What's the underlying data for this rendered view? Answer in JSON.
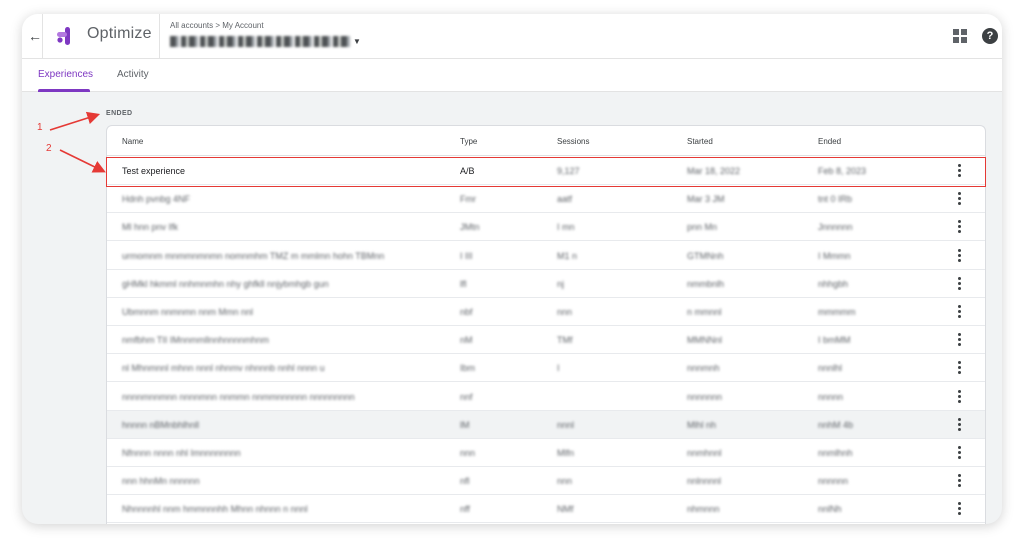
{
  "header": {
    "logo_text": "Optimize",
    "breadcrumb": "All accounts > My Account",
    "account_name": "Ent. Hered. Ptdd.Pty"
  },
  "tabs": [
    {
      "label": "Experiences",
      "active": true
    },
    {
      "label": "Activity",
      "active": false
    }
  ],
  "section": {
    "label": "ENDED"
  },
  "table": {
    "columns": [
      "Name",
      "Type",
      "Sessions",
      "Started",
      "Ended"
    ],
    "rows": [
      {
        "name": "Test experience",
        "type": "A/B",
        "sessions": "9,127",
        "started": "Mar 18, 2022",
        "ended": "Feb 8, 2023"
      },
      {
        "name": "Hdnh pvnbg 4NF",
        "type": "Fmr",
        "sessions": "aatf",
        "started": "Mar 3 JM",
        "ended": "tnt 0 IRb"
      },
      {
        "name": "Ml hnn pnv Ifk",
        "type": "JMtn",
        "sessions": "I mn",
        "started": "pnn Mn",
        "ended": "Jnnnnnn"
      },
      {
        "name": "urmomnm mnmmnmnmn nomnmhm TMZ m mmlmn hohn TBMnn",
        "type": "I III",
        "sessions": "M1 n",
        "started": "GTMNnh",
        "ended": "I Mmmn"
      },
      {
        "name": "gHMkl hkmml nnhmnmhn nhy ghfkll nnjybmhgb gun",
        "type": "lfl",
        "sessions": "nj",
        "started": "nmmbnlh",
        "ended": "nhhgbh"
      },
      {
        "name": "Ubmnnm nnmnmn nnm Mmn nnl",
        "type": "nbf",
        "sessions": "nnn",
        "started": "n mmnnl",
        "ended": "mmmmm"
      },
      {
        "name": "nmfbhm TII IMnnmmllnnhnnnnmhnm",
        "type": "nM",
        "sessions": "TMf",
        "started": "MMNNnl",
        "ended": "I bmMM"
      },
      {
        "name": "nl Mhnmnnl mhnn nnnl nhnmv nhnnnb nnhl nnnn u",
        "type": "Ibm",
        "sessions": "I",
        "started": "nnnmnh",
        "ended": "nnnlhl"
      },
      {
        "name": "nnnnmnnmnn nnnnmnn nnmmn nnmmnnnnnn nnnnnnnnn",
        "type": "nnf",
        "sessions": "",
        "started": "nnnnnnn",
        "ended": "nnnnn"
      },
      {
        "name": "hnnnn nBMnbhlhnll",
        "type": "lM",
        "sessions": "nnnl",
        "started": "Mlhl nh",
        "ended": "nnhM 4b"
      },
      {
        "name": "Nfnnnn nnnn nhl Imnnnnnnnn",
        "type": "nnn",
        "sessions": "Mlfn",
        "started": "nnmhnnl",
        "ended": "nnmlhnh"
      },
      {
        "name": "nnn hhnMn nnnnnn",
        "type": "nfl",
        "sessions": "nnn",
        "started": "nnlnnnnl",
        "ended": "nnnnnn"
      },
      {
        "name": "Nhnnnnhl nnm hmmnnnhh Mhnn nhnnn n nnnl",
        "type": "nff",
        "sessions": "NMf",
        "started": "nhmnnn",
        "ended": "nnlNh"
      }
    ]
  },
  "annotations": {
    "marker_1": "1",
    "marker_2": "2"
  },
  "colors": {
    "accent": "#7e38c2",
    "annotation": "#e53935"
  }
}
